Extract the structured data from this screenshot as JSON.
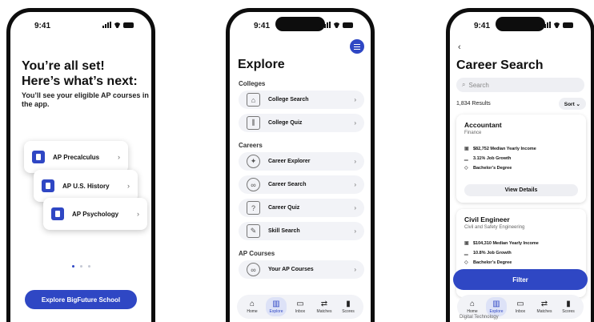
{
  "status": {
    "time": "9:41"
  },
  "screen1": {
    "title_line1": "You’re all set!",
    "title_line2": "Here’s what’s next:",
    "subtitle": "You’ll see your eligible AP courses in the app.",
    "cards": [
      "AP Precalculus",
      "AP U.S. History",
      "AP Psychology"
    ],
    "chevron": "›",
    "pagination": {
      "total": 3,
      "active": 1
    },
    "cta": "Explore BigFuture School"
  },
  "screen2": {
    "title": "Explore",
    "chevron": "›",
    "sections": {
      "colleges": "Colleges",
      "careers": "Careers",
      "ap": "AP Courses"
    },
    "items": {
      "college_search": {
        "label": "College Search",
        "icon": "college-building-icon"
      },
      "college_quiz": {
        "label": "College Quiz",
        "icon": "bank-columns-icon"
      },
      "career_explorer": {
        "label": "Career Explorer",
        "icon": "compass-icon"
      },
      "career_search": {
        "label": "Career Search",
        "icon": "binoculars-icon"
      },
      "career_quiz": {
        "label": "Career Quiz",
        "icon": "quiz-icon"
      },
      "skill_search": {
        "label": "Skill Search",
        "icon": "skill-icon"
      },
      "ap_courses": {
        "label": "Your AP Courses",
        "icon": "binoculars-icon"
      }
    }
  },
  "tabs": [
    {
      "label": "Home",
      "icon": "home-icon"
    },
    {
      "label": "Explore",
      "icon": "map-icon"
    },
    {
      "label": "Inbox",
      "icon": "inbox-icon"
    },
    {
      "label": "Matches",
      "icon": "repeat-icon"
    },
    {
      "label": "Scores",
      "icon": "bar-chart-icon"
    }
  ],
  "active_tab": "Explore",
  "screen3": {
    "back": "‹",
    "title": "Career Search",
    "search_placeholder": "Search",
    "results": "1,834 Results",
    "sort": "Sort ⌄",
    "careers": [
      {
        "name": "Accountant",
        "cluster": "Finance",
        "income": "$82,752 Median Yearly Income",
        "growth": "3.11% Job Growth",
        "degree": "Bachelor’s Degree",
        "action": "View Details"
      },
      {
        "name": "Civil Engineer",
        "cluster": "Civil and Safety Engineering",
        "income": "$104,310 Median Yearly Income",
        "growth": "10.8% Job Growth",
        "degree": "Bachelor’s Degree"
      }
    ],
    "filter": "Filter",
    "peek": "Digital Technology"
  },
  "colors": {
    "accent": "#2f47c4",
    "surface": "#f2f3f7"
  }
}
